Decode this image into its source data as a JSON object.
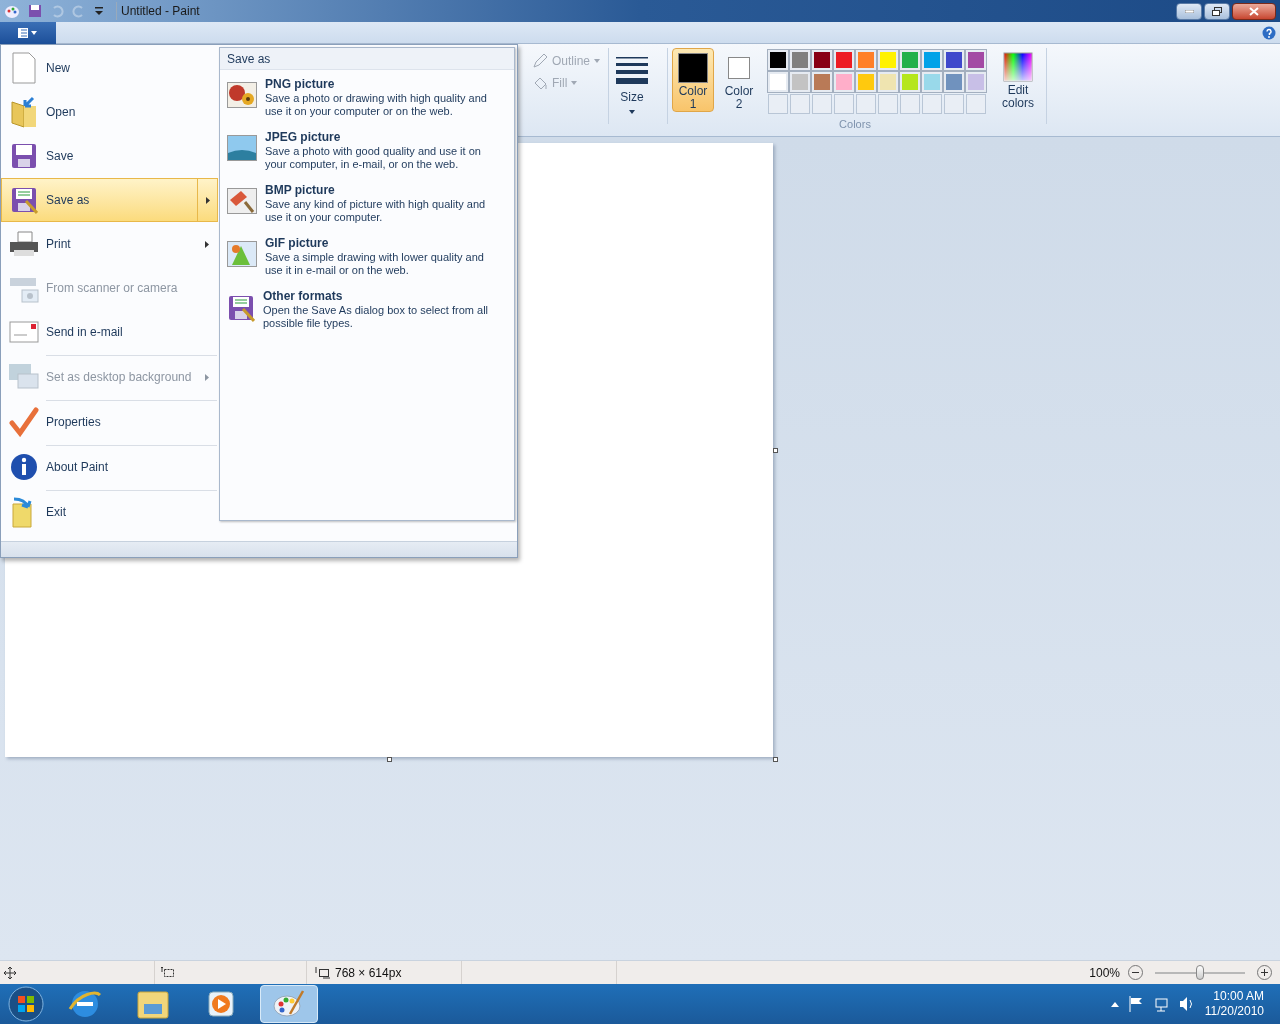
{
  "title_bar": {
    "title": "Untitled - Paint"
  },
  "ribbon": {
    "shapes": [
      {
        "label": "Outline",
        "disabled": true
      },
      {
        "label": "Fill",
        "disabled": true
      }
    ],
    "size": {
      "label": "Size"
    },
    "colors": {
      "group_label": "Colors",
      "edit_label": "Edit colors",
      "slots": [
        {
          "label": "Color 1",
          "color": "#000000",
          "selected": true
        },
        {
          "label": "Color 2",
          "color": "#ffffff",
          "selected": false
        }
      ],
      "palette": [
        {
          "color": "#000000"
        },
        {
          "color": "#7f7f7f"
        },
        {
          "color": "#880015"
        },
        {
          "color": "#ed1c24"
        },
        {
          "color": "#ff7f27"
        },
        {
          "color": "#fff200"
        },
        {
          "color": "#22b14c"
        },
        {
          "color": "#00a2e8"
        },
        {
          "color": "#3f48cc"
        },
        {
          "color": "#a349a4"
        },
        {
          "color": "#ffffff"
        },
        {
          "color": "#c3c3c3"
        },
        {
          "color": "#b97a57"
        },
        {
          "color": "#ffaec9"
        },
        {
          "color": "#ffc90e"
        },
        {
          "color": "#efe4b0"
        },
        {
          "color": "#b5e61d"
        },
        {
          "color": "#99d9ea"
        },
        {
          "color": "#7092be"
        },
        {
          "color": "#c8bfe7"
        }
      ]
    }
  },
  "file_menu": {
    "items": [
      {
        "label": "New",
        "disabled": false,
        "selected": false,
        "submenu": false,
        "separator_before": false
      },
      {
        "label": "Open",
        "disabled": false,
        "selected": false,
        "submenu": false,
        "separator_before": false
      },
      {
        "label": "Save",
        "disabled": false,
        "selected": false,
        "submenu": false,
        "separator_before": false
      },
      {
        "label": "Save as",
        "disabled": false,
        "selected": true,
        "submenu": true,
        "separator_before": false
      },
      {
        "label": "Print",
        "disabled": false,
        "selected": false,
        "submenu": true,
        "separator_before": false
      },
      {
        "label": "From scanner or camera",
        "disabled": true,
        "selected": false,
        "submenu": false,
        "separator_before": false
      },
      {
        "label": "Send in e-mail",
        "disabled": false,
        "selected": false,
        "submenu": false,
        "separator_before": false
      },
      {
        "label": "Set as desktop background",
        "disabled": true,
        "selected": false,
        "submenu": true,
        "separator_before": true
      },
      {
        "label": "Properties",
        "disabled": false,
        "selected": false,
        "submenu": false,
        "separator_before": true
      },
      {
        "label": "About Paint",
        "disabled": false,
        "selected": false,
        "submenu": false,
        "separator_before": true
      },
      {
        "label": "Exit",
        "disabled": false,
        "selected": false,
        "submenu": false,
        "separator_before": true
      }
    ],
    "submenu": {
      "title": "Save as",
      "items": [
        {
          "title": "PNG picture",
          "description": "Save a photo or drawing with high quality and use it on your computer or on the web."
        },
        {
          "title": "JPEG picture",
          "description": "Save a photo with good quality and use it on your computer, in e-mail, or on the web."
        },
        {
          "title": "BMP picture",
          "description": "Save any kind of picture with high quality and use it on your computer."
        },
        {
          "title": "GIF picture",
          "description": "Save a simple drawing with lower quality and use it in e-mail or on the web."
        },
        {
          "title": "Other formats",
          "description": "Open the Save As dialog box to select from all possible file types."
        }
      ]
    }
  },
  "status_bar": {
    "canvas_size": "768 × 614px",
    "zoom": "100%",
    "zoom_slider": {
      "level": 0.5
    }
  },
  "taskbar": {
    "apps": [
      {
        "selected": false
      },
      {
        "selected": false
      },
      {
        "selected": false
      },
      {
        "selected": true
      }
    ],
    "time": "10:00 AM",
    "date": "11/20/2010"
  }
}
